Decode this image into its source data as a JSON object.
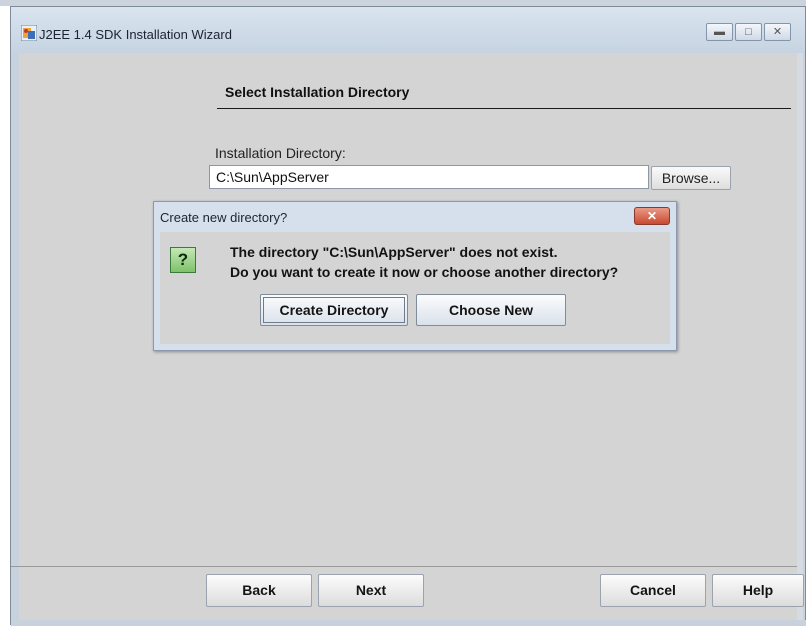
{
  "window": {
    "title": "J2EE 1.4 SDK Installation Wizard",
    "icon": "java-installer-icon",
    "controls": {
      "minimize": "minimize-icon",
      "maximize": "maximize-icon",
      "close": "close-icon"
    }
  },
  "page": {
    "section_title": "Select Installation Directory",
    "directory_label": "Installation Directory:",
    "directory_value": "C:\\Sun\\AppServer",
    "browse_label": "Browse..."
  },
  "dialog": {
    "title": "Create new directory?",
    "icon": "question-icon",
    "icon_text": "?",
    "message_line1": "The directory \"C:\\Sun\\AppServer\" does not exist.",
    "message_line2": "Do you want to create it now or choose another directory?",
    "create_label": "Create Directory",
    "choose_label": "Choose New"
  },
  "footer": {
    "back_label": "Back",
    "next_label": "Next",
    "cancel_label": "Cancel",
    "help_label": "Help"
  }
}
